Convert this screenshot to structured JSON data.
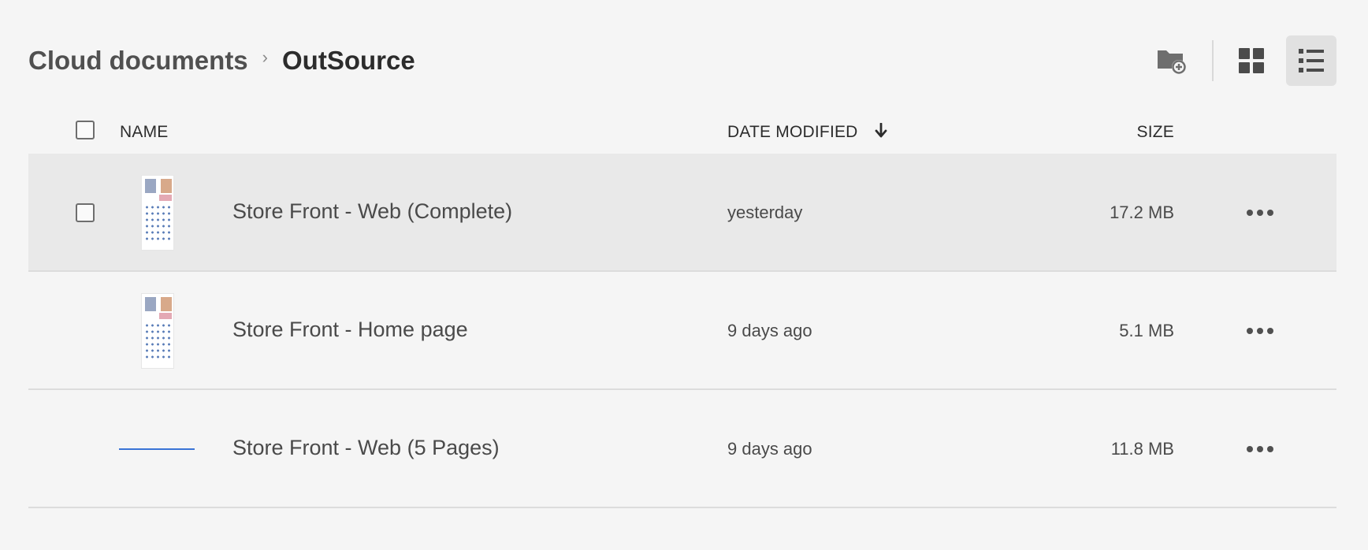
{
  "breadcrumb": {
    "parent": "Cloud documents",
    "separator": "›",
    "current": "OutSource"
  },
  "toolbar": {
    "new_folder_icon": "folder-plus-icon",
    "grid_view_icon": "grid-view-icon",
    "list_view_icon": "list-view-icon",
    "active_view": "list"
  },
  "table": {
    "columns": {
      "name": "NAME",
      "date_modified": "DATE MODIFIED",
      "size": "SIZE"
    },
    "sort": {
      "column": "date_modified",
      "direction": "descending",
      "icon": "arrow-down-icon"
    },
    "rows": [
      {
        "name": "Store Front - Web (Complete)",
        "date": "yesterday",
        "size": "17.2 MB",
        "selected": true,
        "thumbnail": "page-thumbnail"
      },
      {
        "name": "Store Front - Home page",
        "date": "9 days ago",
        "size": "5.1 MB",
        "selected": false,
        "thumbnail": "page-thumbnail"
      },
      {
        "name": "Store Front - Web (5 Pages)",
        "date": "9 days ago",
        "size": "11.8 MB",
        "selected": false,
        "thumbnail": "blank-line-thumbnail"
      }
    ]
  },
  "colors": {
    "background": "#f5f5f5",
    "selected_row": "#e9e9e9",
    "accent_line": "#3a74d6"
  }
}
